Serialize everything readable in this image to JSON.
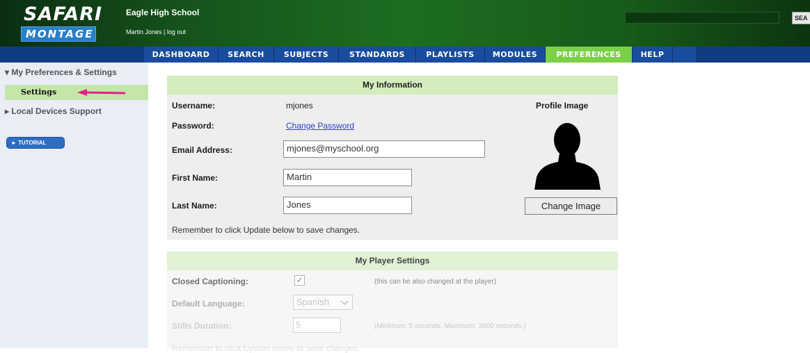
{
  "header": {
    "logo_line1": "SAFARI",
    "logo_line2": "MONTAGE",
    "school_name": "Eagle High School",
    "user_name": "Martin Jones",
    "separator": " | ",
    "logout": "log out",
    "search_button": "SEA"
  },
  "nav": {
    "items": [
      {
        "label": "DASHBOARD"
      },
      {
        "label": "SEARCH"
      },
      {
        "label": "SUBJECTS"
      },
      {
        "label": "STANDARDS"
      },
      {
        "label": "PLAYLISTS"
      },
      {
        "label": "MODULES"
      },
      {
        "label": "PREFERENCES"
      },
      {
        "label": "HELP"
      }
    ],
    "active": "PREFERENCES"
  },
  "sidebar": {
    "prefs_heading": "▾ My Preferences & Settings",
    "settings_item": "Settings",
    "local_devices": "▸ Local Devices Support",
    "tutorial_button": "► TUTORIAL"
  },
  "my_information": {
    "title": "My Information",
    "username_label": "Username:",
    "username_value": "mjones",
    "password_label": "Password:",
    "password_link": "Change Password",
    "email_label": "Email Address:",
    "email_value": "mjones@myschool.org",
    "first_name_label": "First Name:",
    "first_name_value": "Martin",
    "last_name_label": "Last Name:",
    "last_name_value": "Jones",
    "profile_image_label": "Profile Image",
    "change_image_button": "Change Image",
    "note": "Remember to click Update below to save changes."
  },
  "player_settings": {
    "title": "My Player Settings",
    "closed_captioning_label": "Closed Captioning:",
    "closed_captioning_checked": true,
    "closed_captioning_check": "✓",
    "closed_captioning_hint": "(this can be also changed at the player)",
    "default_language_label": "Default Language:",
    "default_language_value": "Spanish",
    "stills_duration_label": "Stills Duration:",
    "stills_duration_value": "5",
    "stills_duration_hint": "(Minimum: 5 seconds, Maximum: 3600 seconds.)",
    "note": "Remember to click Update below to save changes."
  },
  "colors": {
    "header_green": "#1d6e20",
    "nav_blue": "#1a4c9e",
    "nav_active": "#7bd048",
    "panel_head": "#d3edbd",
    "settings_highlight": "#c5e6a8",
    "annotation_arrow": "#e0218a",
    "link": "#2f3fc8"
  }
}
